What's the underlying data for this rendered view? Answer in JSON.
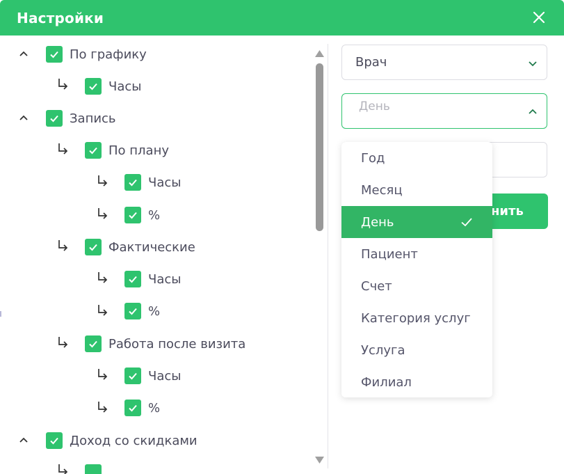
{
  "dialog": {
    "title": "Настройки",
    "close_icon": "close-icon"
  },
  "tree": [
    {
      "label": "По графику",
      "checked": true,
      "expanded": true
    },
    {
      "label": "Часы",
      "checked": true
    },
    {
      "label": "Запись",
      "checked": true,
      "expanded": true
    },
    {
      "label": "По плану",
      "checked": true
    },
    {
      "label": "Часы",
      "checked": true
    },
    {
      "label": "%",
      "checked": true
    },
    {
      "label": "Фактические",
      "checked": true
    },
    {
      "label": "Часы",
      "checked": true
    },
    {
      "label": "%",
      "checked": true
    },
    {
      "label": "Работа после визита",
      "checked": true
    },
    {
      "label": "Часы",
      "checked": true
    },
    {
      "label": "%",
      "checked": true
    },
    {
      "label": "Доход со скидками",
      "checked": true,
      "expanded": true
    }
  ],
  "filters": {
    "group1": {
      "value": "Врач"
    },
    "group2": {
      "placeholder": "День",
      "open": true
    }
  },
  "save_button": {
    "label_visible": "нить"
  },
  "dropdown": {
    "items": [
      "Год",
      "Месяц",
      "День",
      "Пациент",
      "Счет",
      "Категория услуг",
      "Услуга",
      "Филиал"
    ],
    "selected": "День"
  },
  "colors": {
    "accent": "#2fc36e",
    "selected_bg": "#32b565",
    "text": "#4b4b5c"
  }
}
